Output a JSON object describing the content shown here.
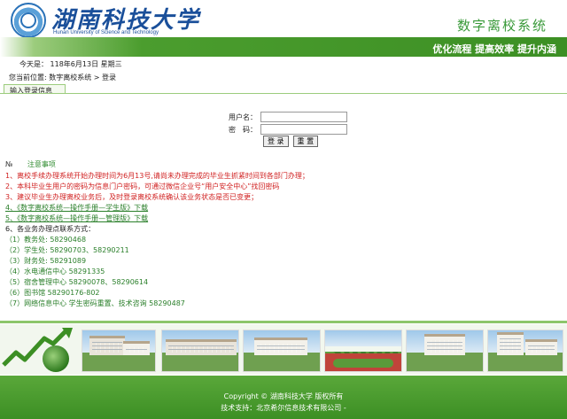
{
  "header": {
    "logo_cn": "湖南科技大学",
    "logo_en": "Hunan University of Science and Technology",
    "system_name": "数字离校系统",
    "slogan": "优化流程 提高效率 提升内涵"
  },
  "date_bar": {
    "text": "今天是： 118年6月13日 星期三"
  },
  "breadcrumb": {
    "text": "您当前位置: 数字离校系统 > 登录"
  },
  "tab": {
    "label": "输入登录信息"
  },
  "login": {
    "username_label": "用户名：",
    "password_label": "密　码：",
    "username_value": "",
    "password_value": "",
    "login_button": "登 录",
    "reset_button": "重 置"
  },
  "notice": {
    "marker": "№",
    "title": "注意事项",
    "lines": [
      {
        "text": "1、离校手续办理系统开始办理时间为6月13号,请尚未办理完成的毕业生抓紧时间到各部门办理；",
        "style": "red"
      },
      {
        "text": "2、本科毕业生用户的密码为信息门户密码，可通过微信企业号“用户安全中心”找回密码",
        "style": "red"
      },
      {
        "text": "3、建议毕业生办理离校业务后，及时登录离校系统确认该业务状态是否已变更；",
        "style": "red"
      },
      {
        "text": "4、《数字离校系统—操作手册—学生版》下载",
        "style": "link"
      },
      {
        "text": "5、《数字离校系统—操作手册—管理版》下载",
        "style": "link"
      },
      {
        "text": "6、各业务办理点联系方式：",
        "style": "dark"
      },
      {
        "text": "（1）教务处: 58290468",
        "style": "green"
      },
      {
        "text": "（2）学生处: 58290703、58290211",
        "style": "green"
      },
      {
        "text": "（3）财务处: 58291089",
        "style": "green"
      },
      {
        "text": "（4）水电通信中心 58291335",
        "style": "green"
      },
      {
        "text": "（5）宿舍管理中心 58290078、58290614",
        "style": "green"
      },
      {
        "text": "（6）图书馆 58290176-802",
        "style": "green"
      },
      {
        "text": "（7）网络信息中心 学生密码重置、技术咨询 58290487",
        "style": "green"
      }
    ]
  },
  "footer": {
    "copyright": "Copyright © 湖南科技大学 版权所有",
    "support": "技术支持：北京希尔信息技术有限公司 -"
  },
  "colors": {
    "brand_green": "#3c8f24",
    "brand_blue": "#1a4f9a",
    "notice_red": "#d02020",
    "notice_green": "#2a7f2a"
  }
}
